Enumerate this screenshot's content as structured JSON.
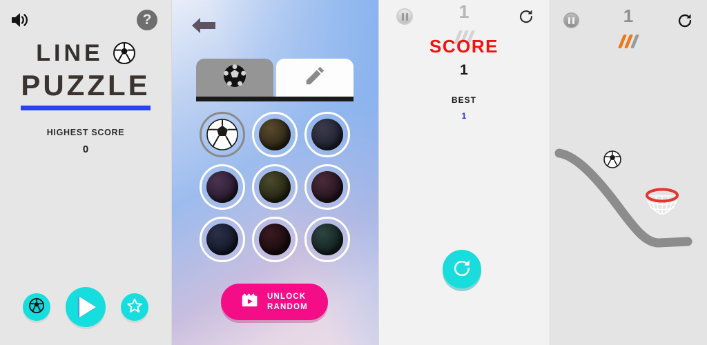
{
  "title_screen": {
    "name": "line-puzzle-title",
    "background": "#E6E6E6",
    "sound_icon": "speaker-on-icon",
    "help_icon": "help-question-icon",
    "help_label": "?",
    "title_line1": "LINE",
    "title_line2": "PUZZLE",
    "title_ball_icon": "soccer-ball-icon",
    "underline_color": "#2B42F0",
    "highest_score_label": "HIGHEST SCORE",
    "highest_score_value": "0",
    "buttons": [
      {
        "name": "shop-button",
        "icon": "soccer-ball-icon",
        "color": "#17DEDE"
      },
      {
        "name": "play-button",
        "icon": "play-triangle-icon",
        "color": "#17DEDE"
      },
      {
        "name": "rate-button",
        "icon": "star-outline-icon",
        "color": "#17DEDE"
      }
    ]
  },
  "shop_screen": {
    "name": "ball-shop",
    "back_icon": "back-arrow-icon",
    "tabs": [
      {
        "name": "tab-balls",
        "icon": "soccer-ball-icon",
        "active": true
      },
      {
        "name": "tab-pencil",
        "icon": "pencil-icon",
        "active": false
      }
    ],
    "balls": [
      {
        "id": 1,
        "selected": true,
        "locked": false,
        "color_a": "#FFFFFF",
        "color_b": "#E4E4E4"
      },
      {
        "id": 2,
        "selected": false,
        "locked": true,
        "color_a": "#584A2C",
        "color_b": "#2B2415"
      },
      {
        "id": 3,
        "selected": false,
        "locked": true,
        "color_a": "#3B3A4A",
        "color_b": "#1E2030"
      },
      {
        "id": 4,
        "selected": false,
        "locked": true,
        "color_a": "#4A3350",
        "color_b": "#261A2C"
      },
      {
        "id": 5,
        "selected": false,
        "locked": true,
        "color_a": "#4A4A2E",
        "color_b": "#23230F"
      },
      {
        "id": 6,
        "selected": false,
        "locked": true,
        "color_a": "#4A2B3A",
        "color_b": "#23121C"
      },
      {
        "id": 7,
        "selected": false,
        "locked": true,
        "color_a": "#2A3048",
        "color_b": "#131726"
      },
      {
        "id": 8,
        "selected": false,
        "locked": true,
        "color_a": "#3A1A20",
        "color_b": "#170A0E"
      },
      {
        "id": 9,
        "selected": false,
        "locked": true,
        "color_a": "#2C4440",
        "color_b": "#12201E"
      }
    ],
    "unlock_button": {
      "name": "unlock-random-button",
      "line1": "UNLOCK",
      "line2": "RANDOM",
      "icon": "video-ad-icon",
      "color": "#F50D87"
    }
  },
  "score_screen": {
    "name": "score-overlay",
    "background": "#F2F2F2",
    "pause_icon": "pause-icon",
    "hud_count": "1",
    "restart_icon": "restart-icon",
    "marks": [
      {
        "color": "#D4D4D4"
      },
      {
        "color": "#D4D4D4"
      },
      {
        "color": "#D4D4D4"
      }
    ],
    "score_label": "SCORE",
    "score_label_color": "#F21212",
    "score_value": "1",
    "best_label": "BEST",
    "best_value": "1",
    "best_value_color": "#2B2BE8",
    "restart_button": {
      "name": "restart-button",
      "icon": "restart-icon",
      "color": "#18DDDC"
    }
  },
  "game_screen": {
    "name": "gameplay",
    "background": "#E4E4E4",
    "pause_icon": "pause-icon",
    "hud_count": "1",
    "restart_icon": "restart-icon",
    "marks": [
      {
        "color": "#F07818"
      },
      {
        "color": "#F07818"
      },
      {
        "color": "#9A9A9A"
      }
    ],
    "ball_icon": "soccer-ball-icon",
    "hoop": {
      "name": "basketball-hoop",
      "rim_color": "#E8332E",
      "net_color": "#FFFFFF"
    },
    "drawn_line": {
      "name": "drawn-path",
      "color": "#8C8C8C"
    }
  }
}
